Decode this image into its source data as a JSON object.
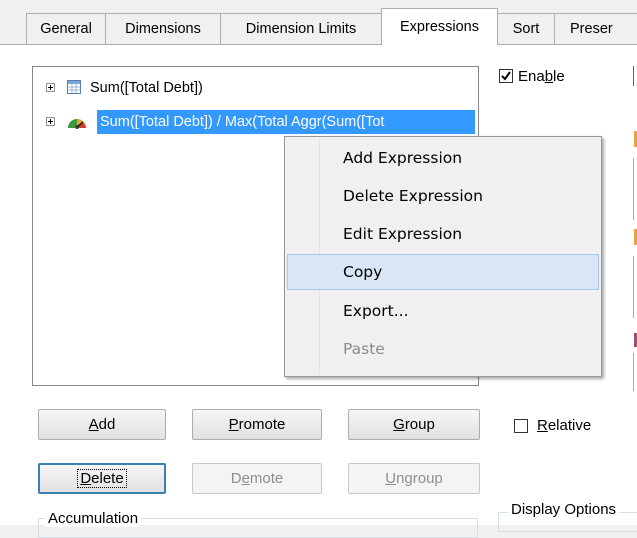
{
  "tabs": [
    {
      "label": "General"
    },
    {
      "label": "Dimensions"
    },
    {
      "label": "Dimension Limits"
    },
    {
      "label": "Expressions"
    },
    {
      "label": "Sort"
    },
    {
      "label": "Preser"
    }
  ],
  "tree": {
    "items": [
      {
        "label": "Sum([Total Debt])",
        "icon": "table-icon"
      },
      {
        "label": "Sum([Total Debt]) / Max(Total Aggr(Sum([Tot",
        "icon": "gauge-icon",
        "selected": true
      }
    ]
  },
  "enable": {
    "label_pre": "Ena",
    "label_u": "b",
    "label_post": "le",
    "checked": true
  },
  "relative": {
    "label_u": "R",
    "label_post": "elative",
    "checked": false
  },
  "buttons": {
    "add": {
      "u": "A",
      "rest": "dd"
    },
    "promote": {
      "u": "P",
      "rest": "romote"
    },
    "group": {
      "u": "G",
      "rest": "roup"
    },
    "delete": {
      "u": "D",
      "rest": "elete"
    },
    "demote": {
      "pre": "D",
      "u": "e",
      "rest": "mote"
    },
    "ungroup": {
      "u": "U",
      "rest": "ngroup"
    }
  },
  "context_menu": {
    "items": [
      {
        "label": "Add Expression"
      },
      {
        "label": "Delete Expression"
      },
      {
        "label": "Edit Expression"
      },
      {
        "label": "Copy"
      },
      {
        "label": "Export..."
      },
      {
        "label": "Paste"
      }
    ]
  },
  "groups": {
    "accumulation": "Accumulation",
    "display_options": "Display Options"
  },
  "colors": {
    "selection": "#3399ff",
    "menu_hover": "#d8e6f5",
    "accent_orange": "#e8a33a"
  }
}
